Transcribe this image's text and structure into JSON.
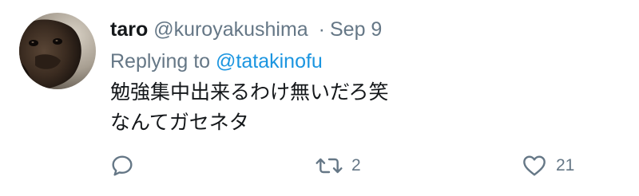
{
  "tweet": {
    "display_name": "taro",
    "handle": "@kuroyakushima",
    "separator": "·",
    "timestamp": "Sep 9",
    "reply_prefix": "Replying to",
    "reply_to": "@tatakinofu",
    "text_line1": "勉強集中出来るわけ無いだろ笑",
    "text_line2": "なんてガセネタ"
  },
  "actions": {
    "reply": {
      "icon": "reply-icon"
    },
    "retweet": {
      "icon": "retweet-icon",
      "count": "2"
    },
    "like": {
      "icon": "heart-icon",
      "count": "21"
    }
  },
  "colors": {
    "text": "#14171a",
    "secondary": "#657786",
    "link": "#1b95e0"
  }
}
